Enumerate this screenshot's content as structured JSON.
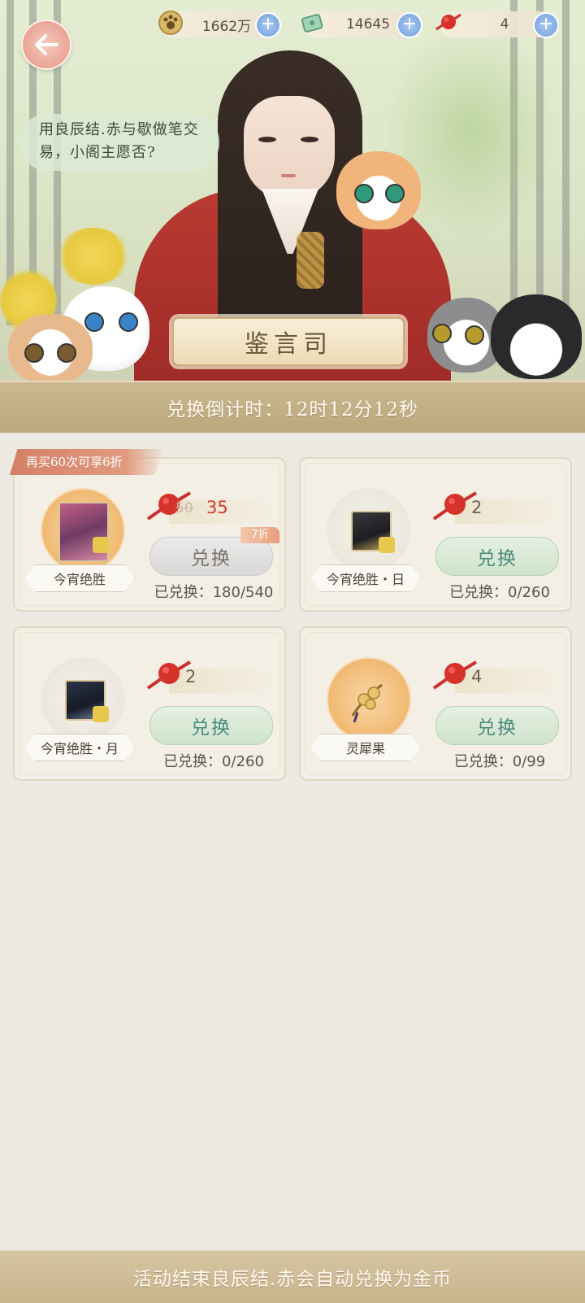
{
  "header": {
    "resources": [
      {
        "icon": "paw-coin-icon",
        "value": "1662万"
      },
      {
        "icon": "jade-ticket-icon",
        "value": "14645"
      },
      {
        "icon": "red-knot-icon",
        "value": "4"
      }
    ]
  },
  "hero": {
    "speech": "用良辰结.赤与歇做笔交易，小阁主愿否?",
    "plaque": "鉴言司"
  },
  "countdown": {
    "text": "兑换倒计时：12时12分12秒"
  },
  "promo": {
    "text": "再买60次可享6折"
  },
  "items": [
    {
      "name": "今宵绝胜",
      "price_old": "50",
      "price": "35",
      "discount": "7折",
      "button": "兑换",
      "exchanged": "已兑换：180/540"
    },
    {
      "name": "今宵绝胜・日",
      "price": "2",
      "button": "兑换",
      "exchanged": "已兑换：0/260"
    },
    {
      "name": "今宵绝胜・月",
      "price": "2",
      "button": "兑换",
      "exchanged": "已兑换：0/260"
    },
    {
      "name": "灵犀果",
      "price": "4",
      "button": "兑换",
      "exchanged": "已兑换：0/99"
    }
  ],
  "footer": {
    "text": "活动结束良辰结.赤会自动兑换为金币"
  },
  "colors": {
    "accent_red": "#d13a2e",
    "button_green_text": "#4b8a7f",
    "banner_gold": "#c9b48d"
  }
}
